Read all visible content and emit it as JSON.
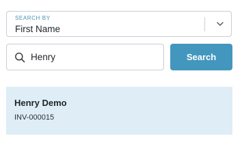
{
  "search_by": {
    "caption": "SEARCH BY",
    "selected_value": "First Name"
  },
  "search": {
    "input_value": "Henry",
    "button_label": "Search"
  },
  "results": [
    {
      "name": "Henry Demo",
      "invoice": "INV-000015"
    }
  ],
  "icons": {
    "search": "search-icon",
    "dropdown": "chevron-down-icon"
  },
  "colors": {
    "accent": "#4397be",
    "caption": "#4a8fb3",
    "result_highlight": "#deedf6",
    "border": "#c8cdd3"
  }
}
